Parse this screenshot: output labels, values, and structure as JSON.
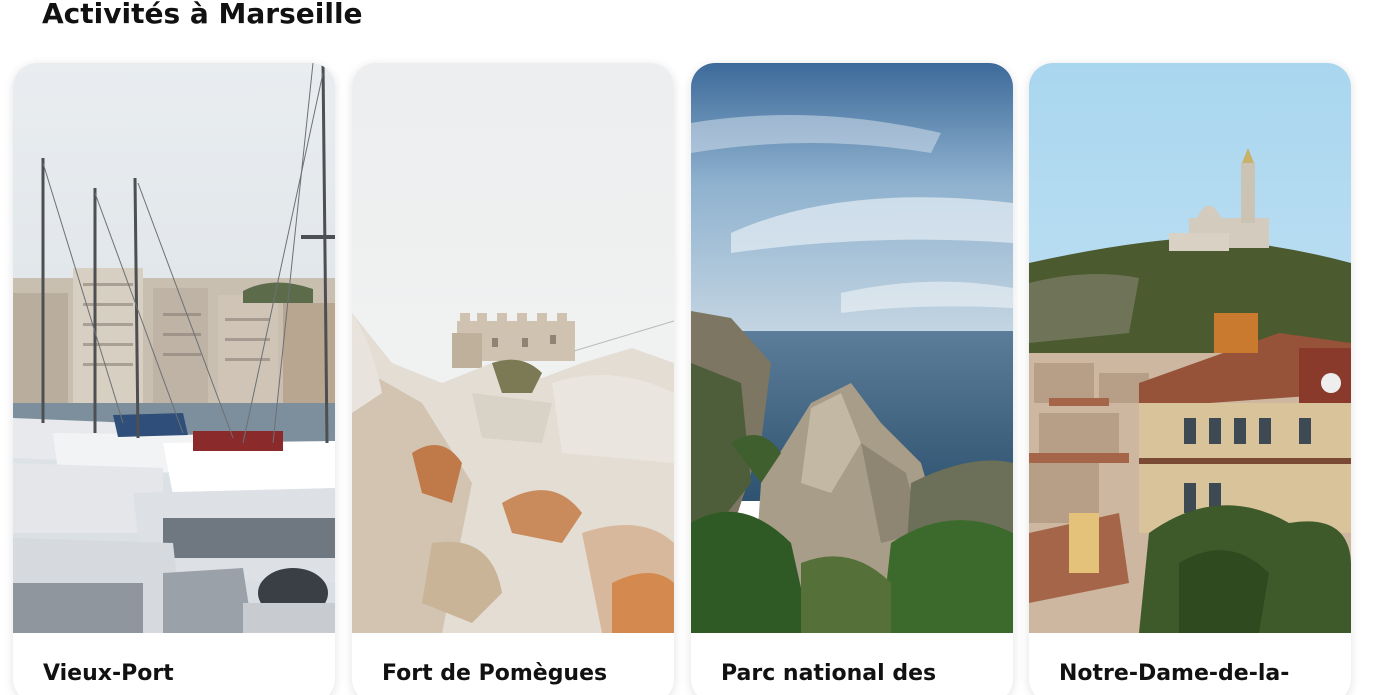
{
  "section": {
    "title": "Activités à Marseille"
  },
  "cards": [
    {
      "title": "Vieux-Port",
      "image": "harbor-boats-photo"
    },
    {
      "title": "Fort de Pomègues",
      "image": "fort-on-rocks-photo"
    },
    {
      "title": "Parc national des",
      "image": "calanques-coast-photo"
    },
    {
      "title": "Notre-Dame-de-la-",
      "image": "basilica-hill-photo"
    }
  ],
  "colors": {
    "text": "#111111",
    "card_background": "#ffffff"
  }
}
